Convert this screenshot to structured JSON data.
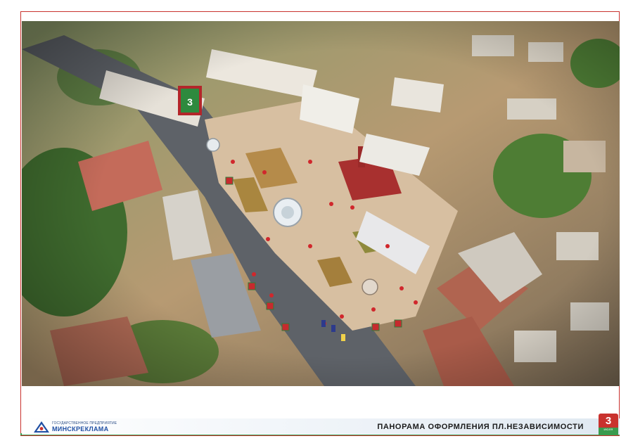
{
  "poster": {
    "caption": "ПАНОРАМА ОФОРМЛЕНИЯ ПЛ.НЕЗАВИСИМОСТИ"
  },
  "logo": {
    "small_text": "Государственное предприятие",
    "name": "МИНСКРЕКЛАМА"
  },
  "badge": {
    "number": "3",
    "subtext": "ИЮЛЯ"
  },
  "billboard": {
    "number": "3"
  },
  "colors": {
    "frame_red": "#c9322e",
    "frame_green": "#3a9b4e",
    "logo_blue": "#1f4fa3"
  }
}
